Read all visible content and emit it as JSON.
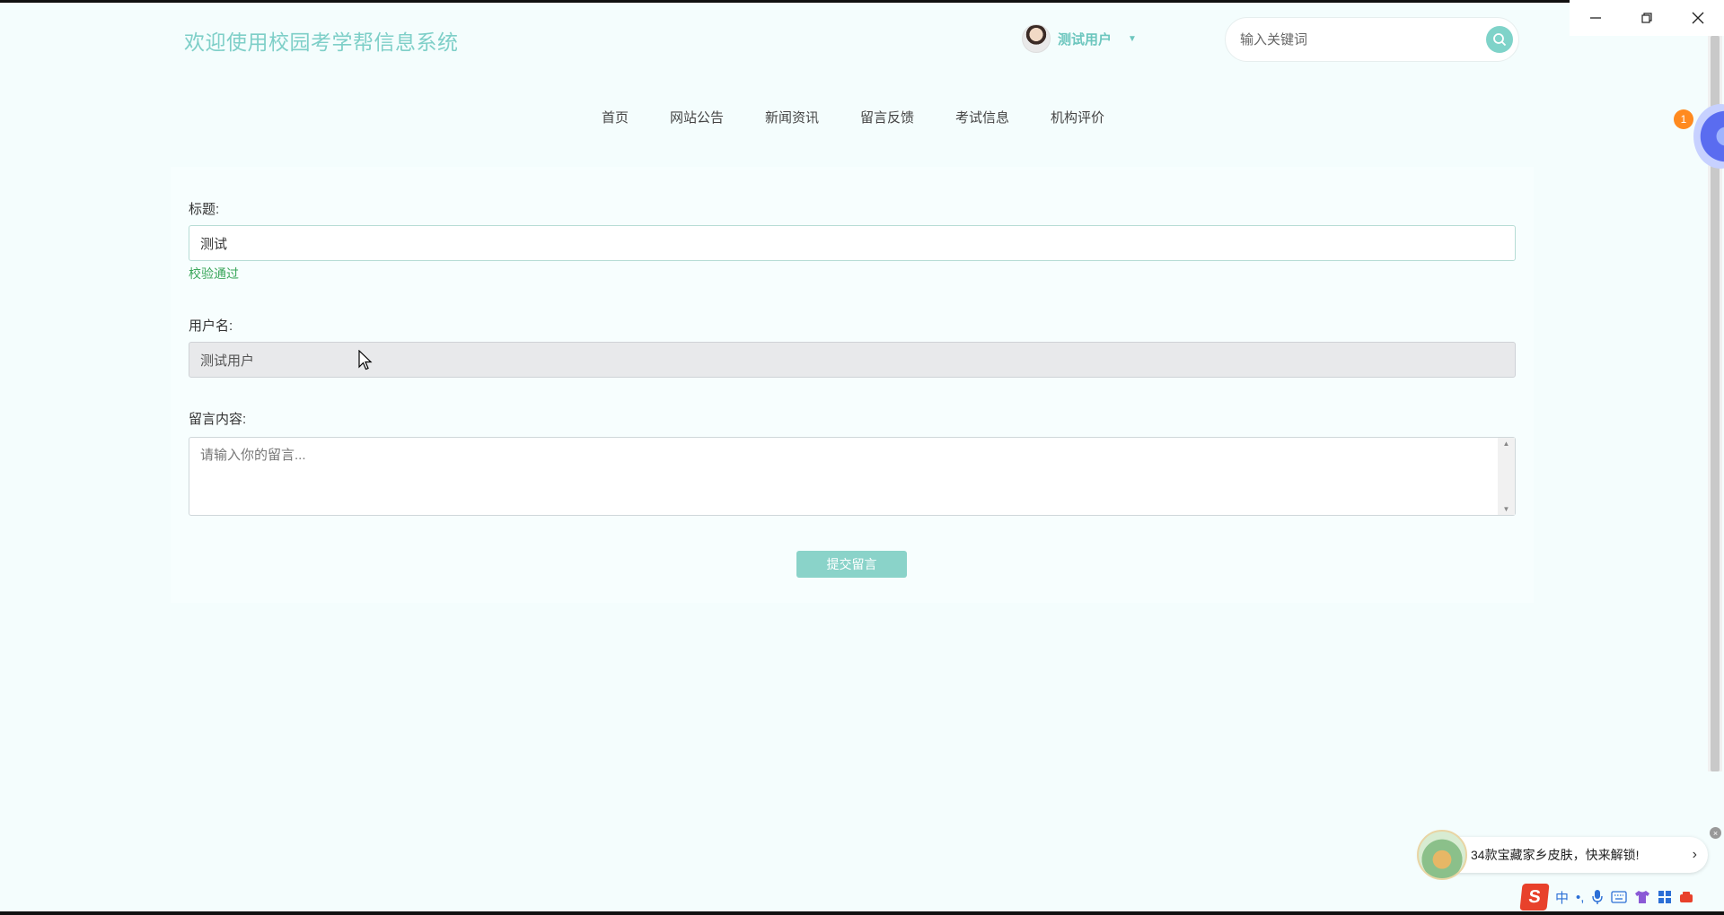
{
  "header": {
    "site_title": "欢迎使用校园考学帮信息系统",
    "user_name": "测试用户",
    "search_placeholder": "输入关键词"
  },
  "nav": {
    "items": [
      "首页",
      "网站公告",
      "新闻资讯",
      "留言反馈",
      "考试信息",
      "机构评价"
    ]
  },
  "form": {
    "title_label": "标题:",
    "title_value": "测试",
    "title_valid_msg": "校验通过",
    "username_label": "用户名:",
    "username_value": "测试用户",
    "content_label": "留言内容:",
    "content_placeholder": "请输入你的留言...",
    "submit_label": "提交留言"
  },
  "assistant": {
    "badge_count": "1"
  },
  "notification": {
    "text": "34款宝藏家乡皮肤，快来解锁!"
  },
  "ime": {
    "logo": "S",
    "mode": "中",
    "punct": "•,"
  },
  "colors": {
    "accent": "#7fd3c9",
    "valid": "#3aa65a",
    "background": "#f4fdfd"
  }
}
